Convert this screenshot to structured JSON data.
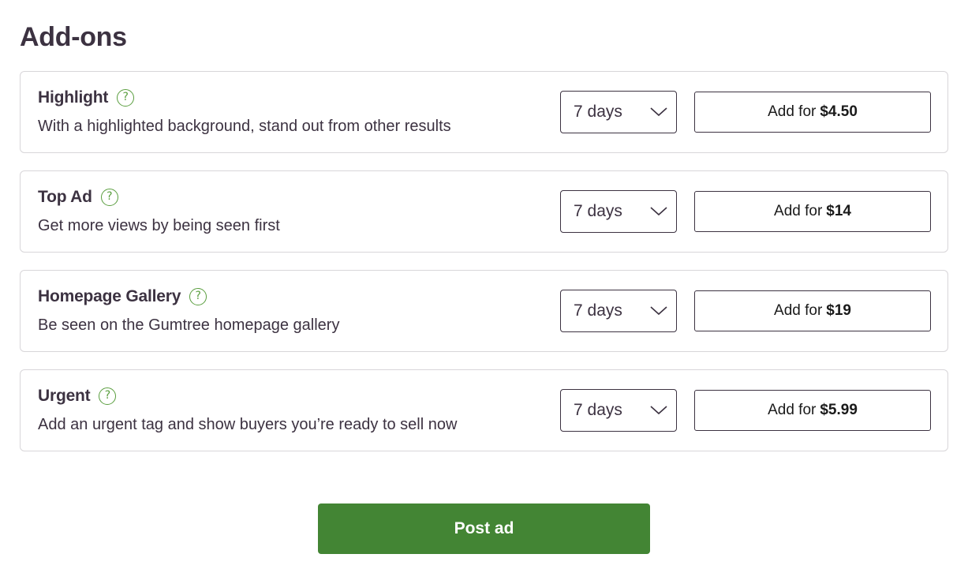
{
  "page": {
    "title": "Add-ons"
  },
  "addons": [
    {
      "name": "Highlight",
      "description": "With a highlighted background, stand out from other results",
      "duration": "7 days",
      "button_prefix": "Add for",
      "price": "$4.50"
    },
    {
      "name": "Top Ad",
      "description": "Get more views by being seen first",
      "duration": "7 days",
      "button_prefix": "Add for",
      "price": "$14"
    },
    {
      "name": "Homepage Gallery",
      "description": "Be seen on the Gumtree homepage gallery",
      "duration": "7 days",
      "button_prefix": "Add for",
      "price": "$19"
    },
    {
      "name": "Urgent",
      "description": "Add an urgent tag and show buyers you’re ready to sell now",
      "duration": "7 days",
      "button_prefix": "Add for",
      "price": "$5.99"
    }
  ],
  "icons": {
    "help": "help-circle-icon",
    "dropdown": "chevron-down-icon"
  },
  "help_glyph": "?",
  "footer": {
    "post_label": "Post ad"
  },
  "colors": {
    "accent": "#438534",
    "help_icon": "#5a9e3f",
    "text": "#3c3241",
    "border": "#d8d6d9"
  }
}
